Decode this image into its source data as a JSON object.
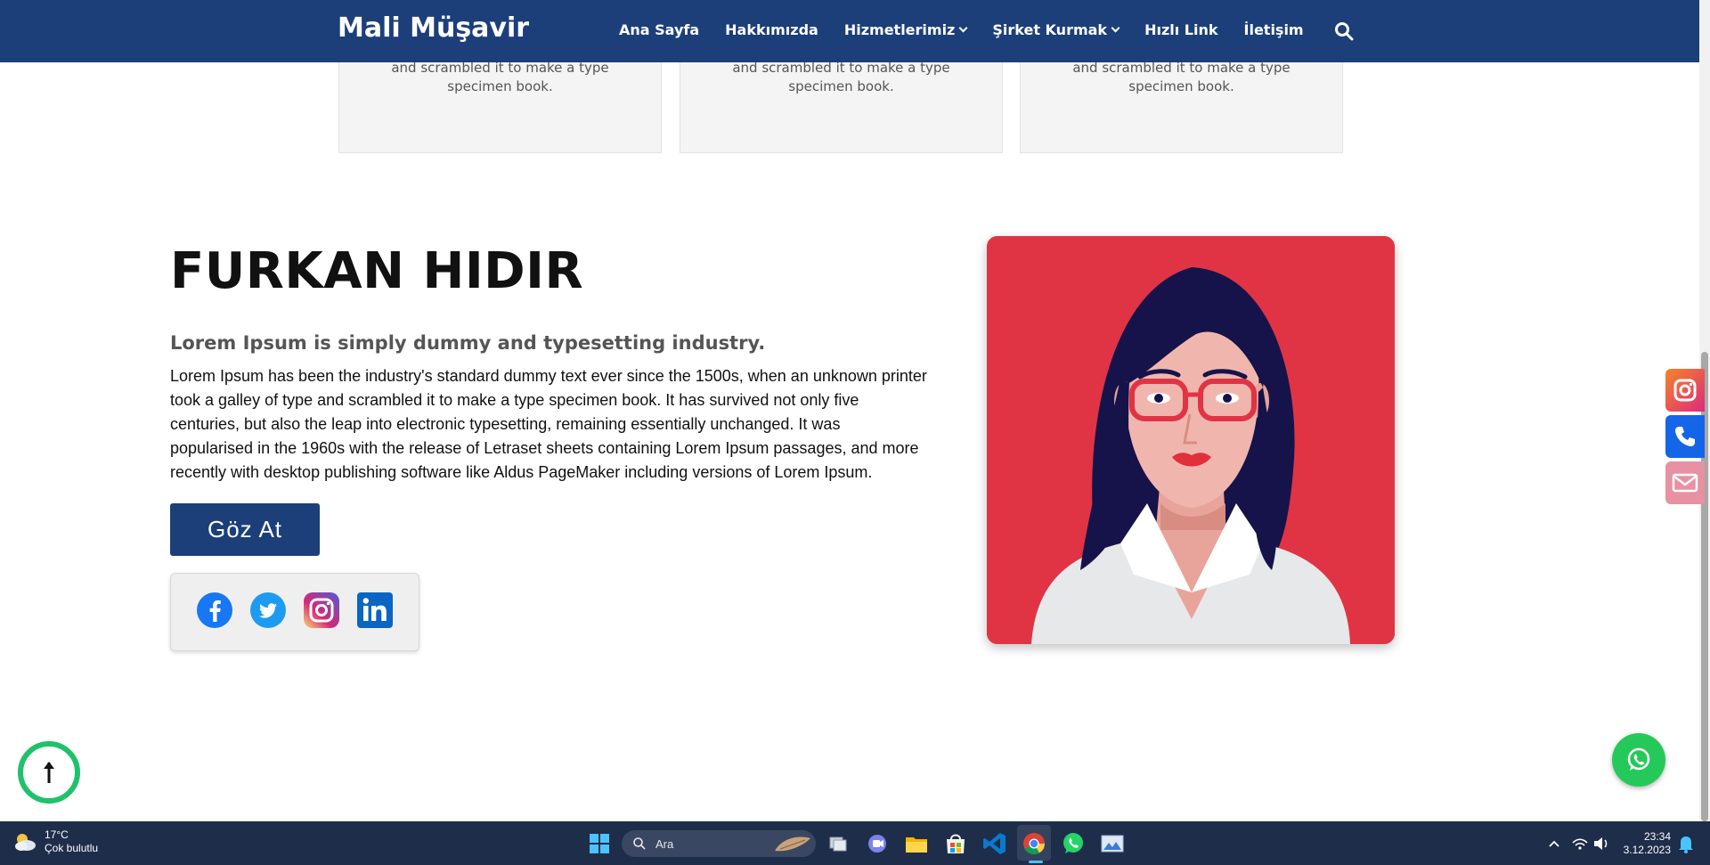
{
  "header": {
    "brand": "Mali Müşavir",
    "nav": [
      {
        "label": "Ana Sayfa"
      },
      {
        "label": "Hakkımızda"
      },
      {
        "label": "Hizmetlerimiz"
      },
      {
        "label": "Şirket Kurmak"
      },
      {
        "label": "Hızlı Link"
      },
      {
        "label": "İletişim"
      }
    ]
  },
  "cards": [
    {
      "text": "and scrambled it to make a type specimen book."
    },
    {
      "text": "and scrambled it to make a type specimen book."
    },
    {
      "text": "and scrambled it to make a type specimen book."
    }
  ],
  "profile": {
    "name": "FURKAN HIDIR",
    "subtitle": "Lorem Ipsum is simply dummy and typesetting industry.",
    "body": "Lorem Ipsum has been the industry's standard dummy text ever since the 1500s, when an unknown printer took a galley of type and scrambled it to make a type specimen book. It has survived not only five centuries, but also the leap into electronic typesetting, remaining essentially unchanged. It was popularised in the 1960s with the release of Letraset sheets containing Lorem Ipsum passages, and more recently with desktop publishing software like Aldus PageMaker including versions of Lorem Ipsum.",
    "cta": "Göz At",
    "socials": [
      "facebook-icon",
      "twitter-icon",
      "instagram-icon",
      "linkedin-icon"
    ]
  },
  "floating": {
    "side_buttons": [
      "instagram-icon",
      "phone-icon",
      "mail-icon"
    ],
    "scroll_top": "arrow-up-icon",
    "whatsapp": "whatsapp-icon"
  },
  "colors": {
    "primary": "#1c3f7a",
    "portrait_bg": "#e03445",
    "whatsapp": "#25c95a"
  },
  "taskbar": {
    "weather_temp": "17°C",
    "weather_desc": "Çok bulutlu",
    "search_placeholder": "Ara",
    "time": "23:34",
    "date": "3.12.2023"
  }
}
